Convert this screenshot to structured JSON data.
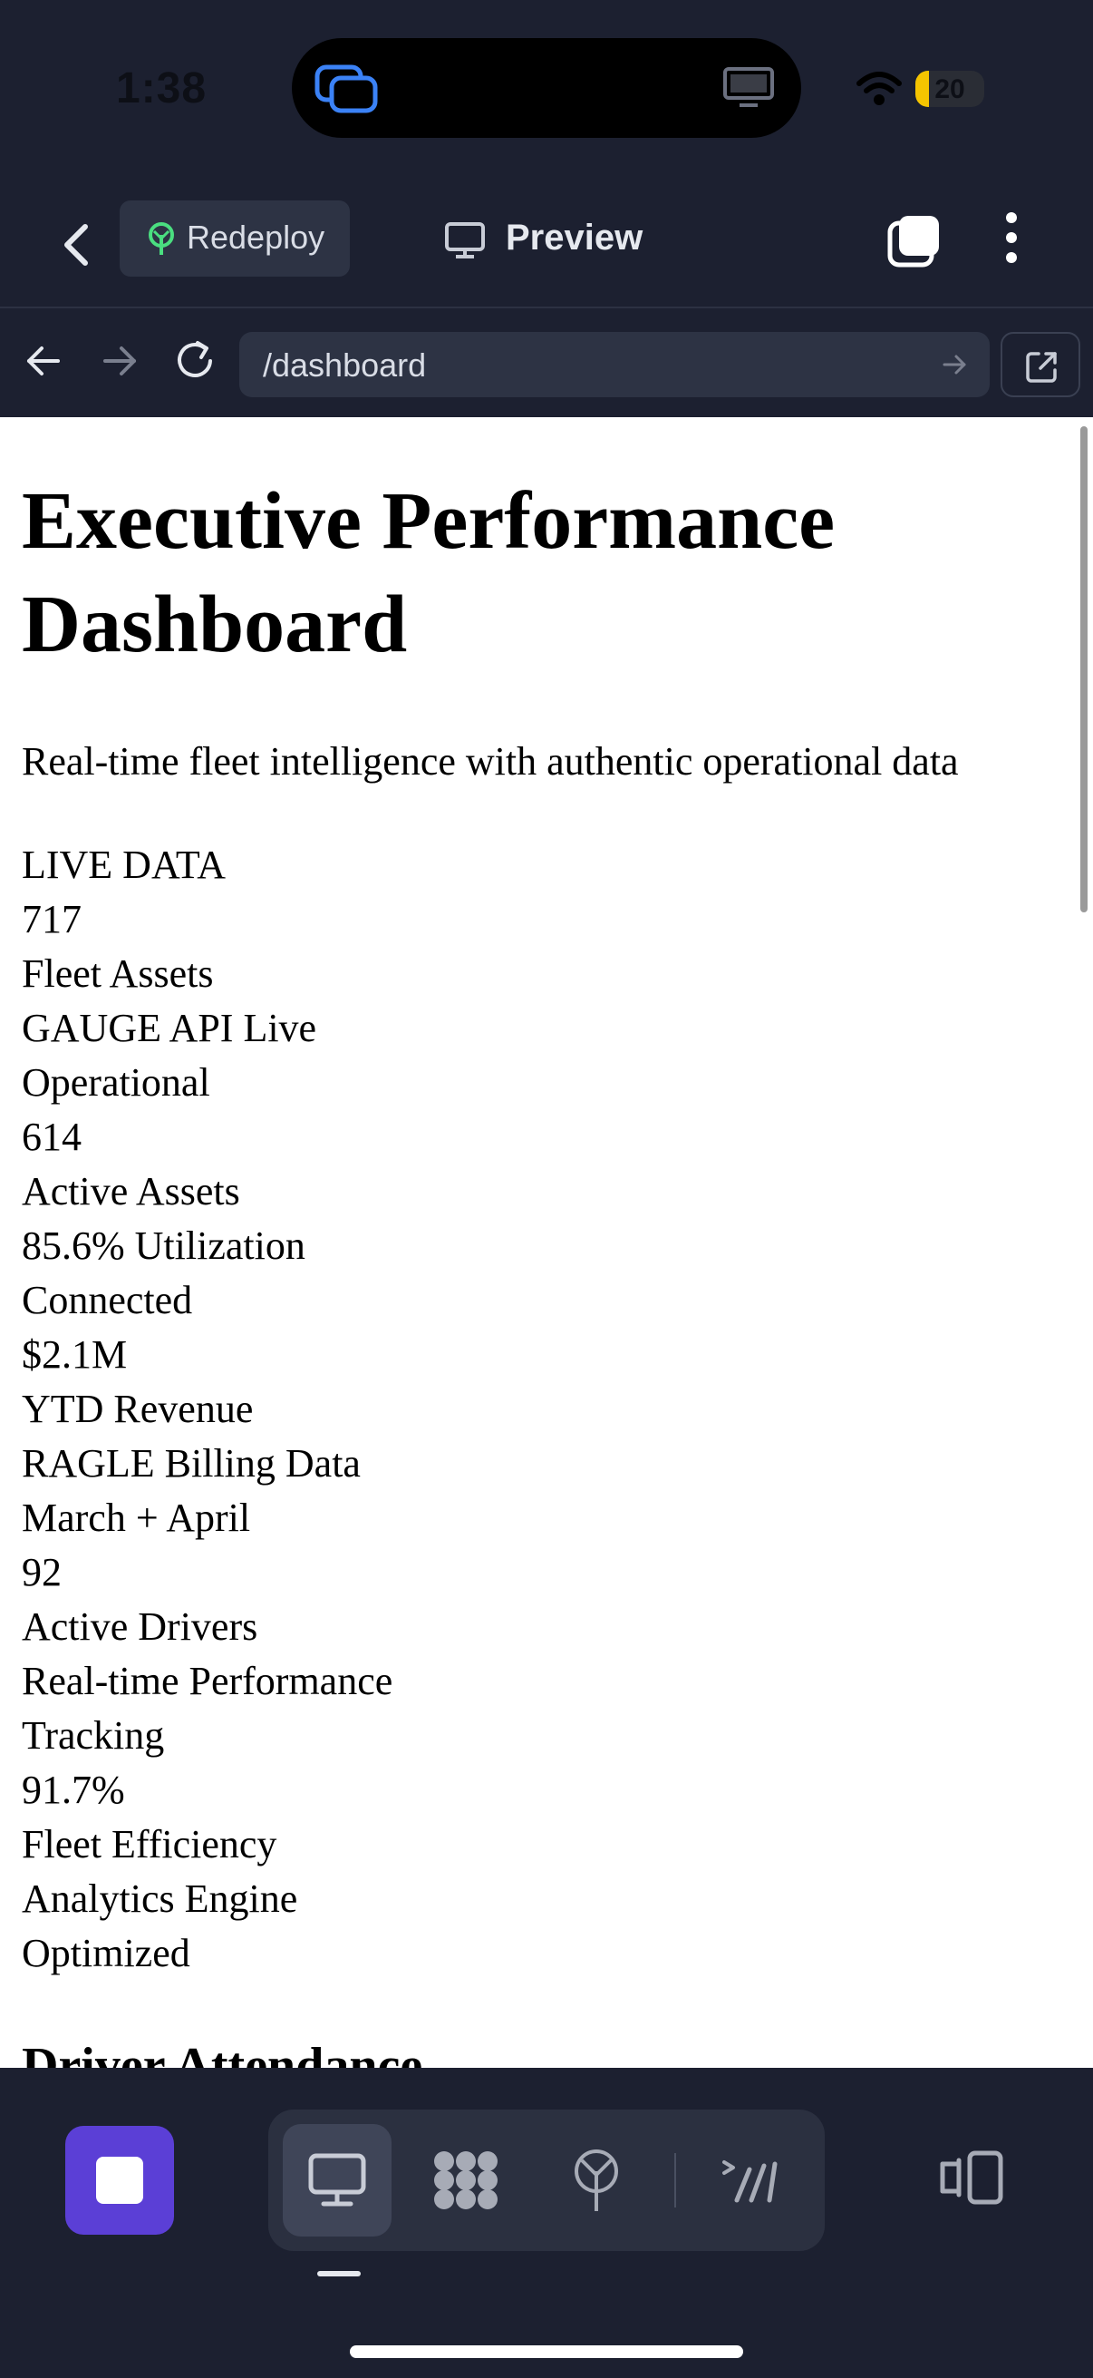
{
  "status_bar": {
    "time": "1:38",
    "battery_level": "20",
    "battery_fraction": 0.2,
    "icons": [
      "screen-share-icon",
      "monitor-icon",
      "wifi-icon",
      "battery-icon"
    ]
  },
  "header": {
    "back_icon": "chevron-left-icon",
    "redeploy_label": "Redeploy",
    "preview_label": "Preview",
    "tabs_icon": "tabs-icon",
    "more_icon": "more-vertical-icon"
  },
  "browser": {
    "url": "/dashboard",
    "icons": [
      "arrow-left-icon",
      "arrow-right-icon",
      "reload-icon",
      "url-go-icon",
      "open-external-icon"
    ]
  },
  "page": {
    "title": "Executive Performance Dashboard",
    "subtitle": "Real-time fleet intelligence with authentic operational data",
    "metrics": [
      "LIVE DATA",
      "717",
      "Fleet Assets",
      "GAUGE API Live",
      "Operational",
      "614",
      "Active Assets",
      "85.6% Utilization",
      "Connected",
      "$2.1M",
      "YTD Revenue",
      "RAGLE Billing Data",
      "March + April",
      "92",
      "Active Drivers",
      "Real-time Performance",
      "Tracking",
      "91.7%",
      "Fleet Efficiency",
      "Analytics Engine",
      "Optimized"
    ],
    "next_section_heading": "Driver Attendance"
  },
  "toolbar": {
    "stop_icon": "stop-icon",
    "segment_items": [
      "desktop-icon",
      "flower-grid-icon",
      "antenna-icon",
      "slash-lines-icon"
    ],
    "active_item": "desktop-icon",
    "split_icon": "split-view-icon"
  },
  "colors": {
    "chrome_bg": "#1c2030",
    "field_bg": "#2d3344",
    "accent_purple": "#5b3fd6",
    "redeploy_green": "#4ade80",
    "battery_yellow": "#f5c400"
  }
}
